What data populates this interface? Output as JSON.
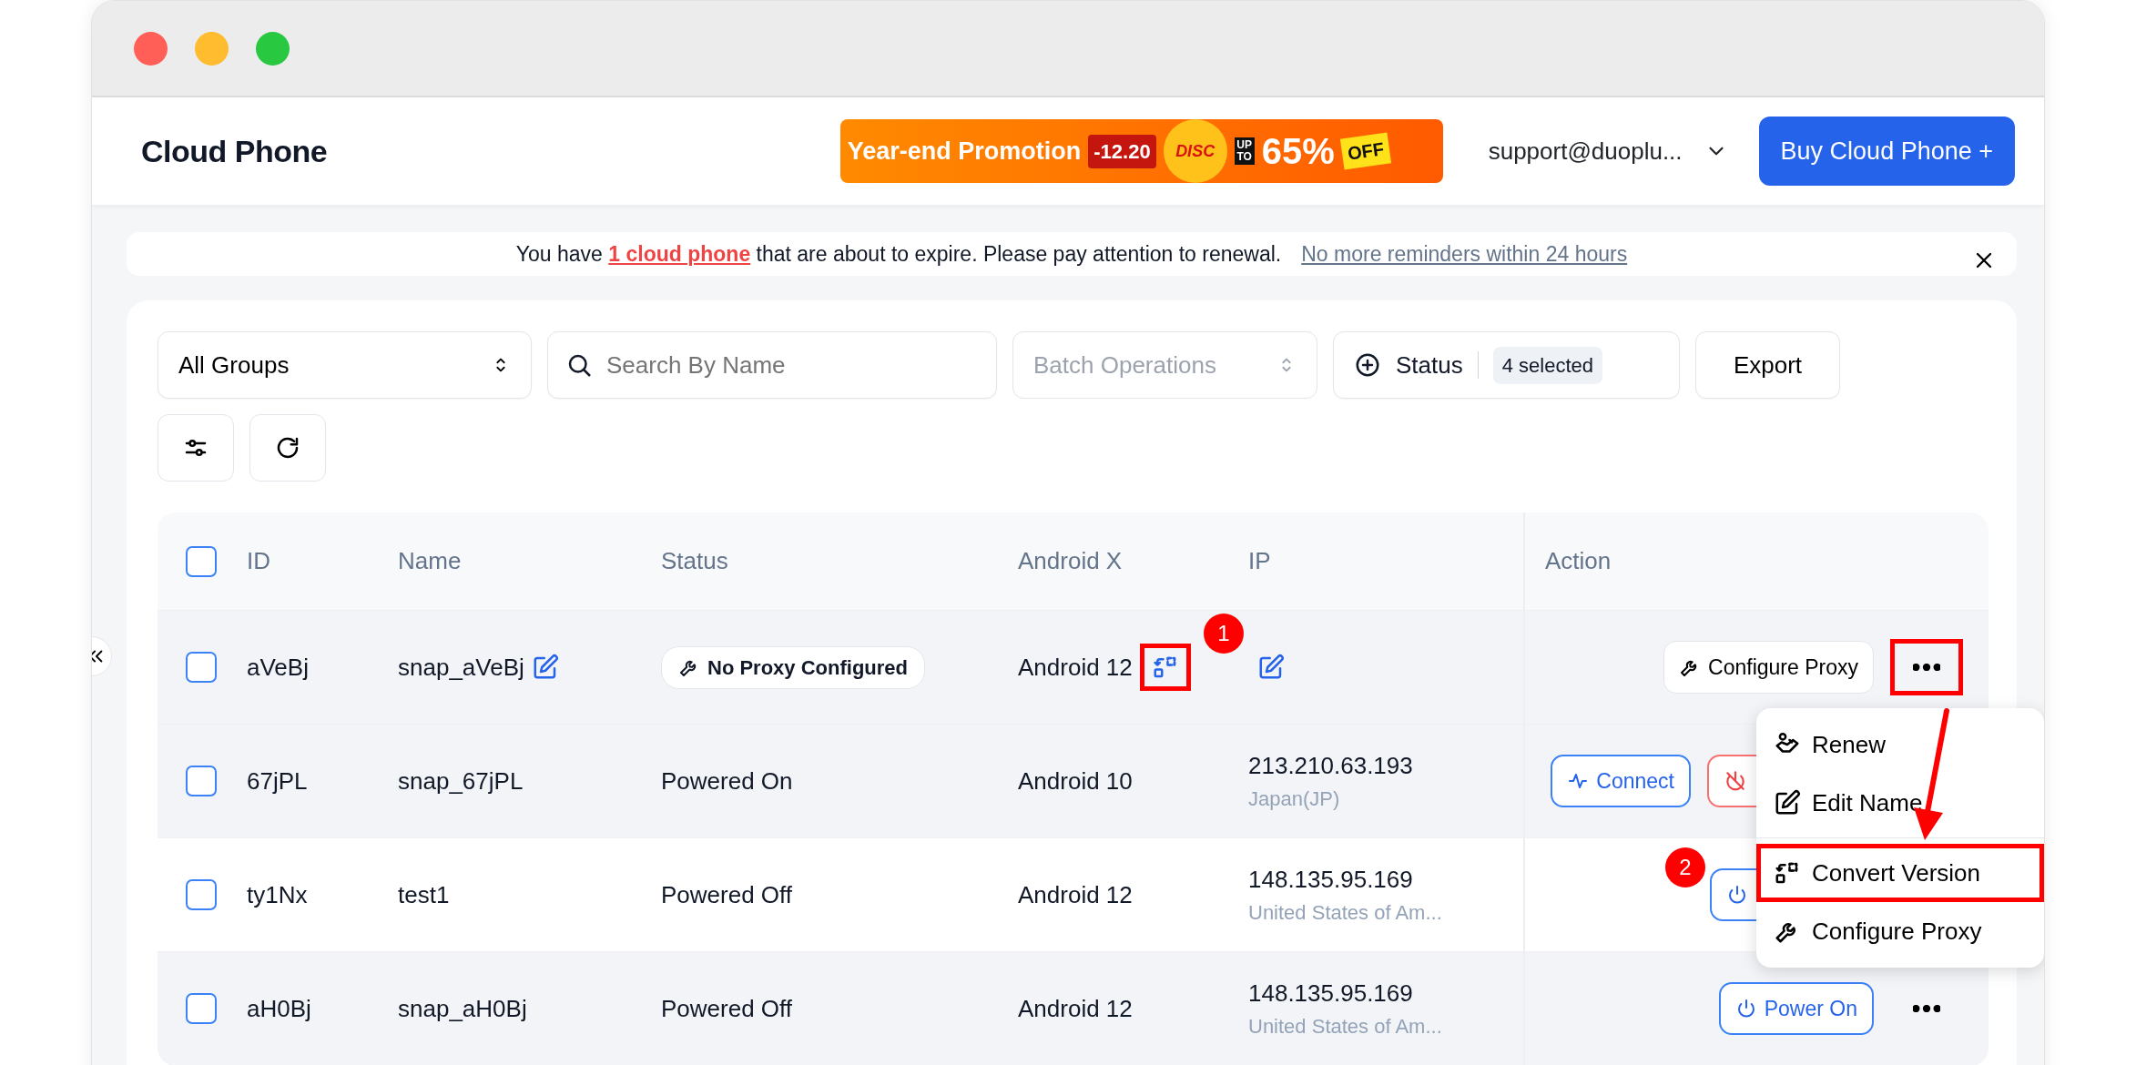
{
  "header": {
    "title": "Cloud Phone",
    "promo": {
      "headline": "Year-end Promotion",
      "date": "-12.20",
      "disc": "DISC",
      "upto": "UP TO",
      "percent": "65%",
      "off": "OFF"
    },
    "account": "support@duoplu...",
    "buy_button": "Buy Cloud Phone +"
  },
  "notice": {
    "text_before": "You have ",
    "link": "1 cloud phone",
    "text_after": " that are about to expire. Please pay attention to renewal.",
    "dismiss": "No more reminders within 24 hours"
  },
  "toolbar": {
    "group_select": "All Groups",
    "search": {
      "placeholder": "Search By Name"
    },
    "batch": {
      "label": "Batch Operations",
      "disabled": true
    },
    "status_filter": {
      "label": "Status",
      "badge": "4 selected"
    },
    "export": "Export"
  },
  "table": {
    "all_checked": false,
    "columns": [
      "ID",
      "Name",
      "Status",
      "Android X",
      "IP",
      "Action"
    ],
    "rows": [
      {
        "checked": false,
        "shaded": true,
        "id": "aVeBj",
        "name": "snap_aVeBj",
        "name_editable": true,
        "status": "No Proxy Configured",
        "kind": "badge",
        "android": "Android 12",
        "convert": {
          "highlighted": true
        },
        "ip_editable": true,
        "more": {
          "highlighted": true
        },
        "actions": [
          {
            "kind": "proxy",
            "label": "Configure Proxy"
          }
        ]
      },
      {
        "checked": false,
        "shaded": true,
        "id": "67jPL",
        "name": "snap_67jPL",
        "name_editable": false,
        "status": "Powered On",
        "kind": "text",
        "android": "Android 10",
        "ip": "213.210.63.193",
        "ip_editable": false,
        "region": "Japan(JP)",
        "actions": [
          {
            "kind": "connect",
            "label": "Connect"
          },
          {
            "kind": "power_off"
          }
        ]
      },
      {
        "checked": false,
        "shaded": false,
        "id": "ty1Nx",
        "name": "test1",
        "name_editable": false,
        "status": "Powered Off",
        "kind": "text",
        "android": "Android 12",
        "ip": "148.135.95.169",
        "ip_editable": false,
        "region": "United States of Am...",
        "actions": [
          {
            "kind": "power_on"
          }
        ]
      },
      {
        "checked": false,
        "shaded": true,
        "id": "aH0Bj",
        "name": "snap_aH0Bj",
        "name_editable": false,
        "status": "Powered Off",
        "kind": "text",
        "android": "Android 12",
        "ip": "148.135.95.169",
        "ip_editable": false,
        "region": "United States of Am...",
        "more": {
          "highlighted": false
        },
        "actions": [
          {
            "kind": "power_on",
            "label": "Power On"
          }
        ]
      }
    ]
  },
  "menu": {
    "items": [
      {
        "kind": "renew",
        "label": "Renew",
        "highlighted": false
      },
      {
        "kind": "edit",
        "label": "Edit Name",
        "highlighted": false
      },
      {
        "kind": "convert",
        "label": "Convert Version",
        "highlighted": true
      },
      {
        "kind": "proxy",
        "label": "Configure Proxy",
        "highlighted": false
      }
    ]
  },
  "annotations": [
    {
      "label": "1"
    },
    {
      "label": "2"
    }
  ]
}
